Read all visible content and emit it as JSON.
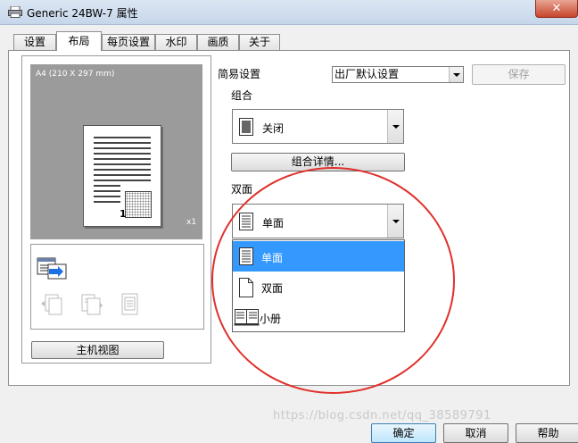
{
  "window": {
    "title": "Generic 24BW-7 属性",
    "close_glyph": "✕"
  },
  "tabs": [
    {
      "label": "设置"
    },
    {
      "label": "布局"
    },
    {
      "label": "每页设置"
    },
    {
      "label": "水印"
    },
    {
      "label": "画质"
    },
    {
      "label": "关于"
    }
  ],
  "preview": {
    "paper_size": "A4 (210 X 297 mm)",
    "copies": "x1",
    "page_number": "1",
    "host_view_button": "主机视图"
  },
  "easy_settings": {
    "label": "简易设置",
    "value": "出厂默认设置",
    "save_button": "保存"
  },
  "combine": {
    "label": "组合",
    "value": "关闭",
    "details_button": "组合详情..."
  },
  "duplex": {
    "label": "双面",
    "value": "单面",
    "options": [
      {
        "label": "单面",
        "icon": "single-sided-icon"
      },
      {
        "label": "双面",
        "icon": "double-sided-icon"
      },
      {
        "label": "小册",
        "icon": "booklet-icon"
      }
    ],
    "selected_index": 0
  },
  "footer": {
    "ok_button": "确定",
    "cancel_button": "取消",
    "help_button": "帮助"
  },
  "watermark_text": "https://blog.csdn.net/qq_38589791",
  "colors": {
    "selection": "#3399ff",
    "annotation_circle": "#e0302b"
  }
}
